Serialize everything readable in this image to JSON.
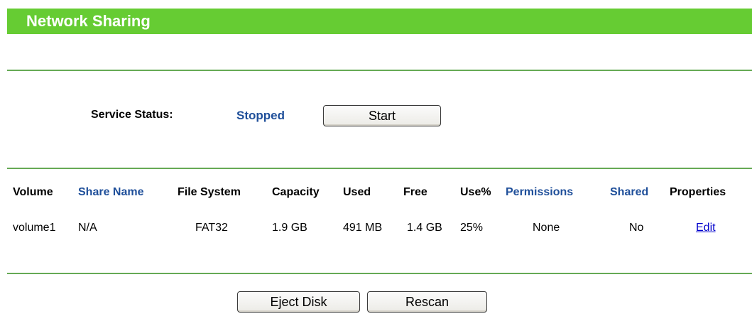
{
  "page": {
    "title": "Network Sharing"
  },
  "service": {
    "label": "Service Status:",
    "value": "Stopped",
    "start_button": "Start"
  },
  "table": {
    "columns": [
      {
        "key": "volume",
        "label": "Volume"
      },
      {
        "key": "share_name",
        "label": "Share Name"
      },
      {
        "key": "file_system",
        "label": "File System"
      },
      {
        "key": "capacity",
        "label": "Capacity"
      },
      {
        "key": "used",
        "label": "Used"
      },
      {
        "key": "free",
        "label": "Free"
      },
      {
        "key": "use_pct",
        "label": "Use%"
      },
      {
        "key": "permissions",
        "label": "Permissions"
      },
      {
        "key": "shared",
        "label": "Shared"
      },
      {
        "key": "properties",
        "label": "Properties"
      }
    ],
    "rows": [
      {
        "volume": "volume1",
        "share_name": "N/A",
        "file_system": "FAT32",
        "capacity": "1.9 GB",
        "used": "491 MB",
        "free": "1.4 GB",
        "use_pct": "25%",
        "permissions": "None",
        "shared": "No",
        "properties": "Edit"
      }
    ]
  },
  "actions": {
    "eject_button": "Eject Disk",
    "rescan_button": "Rescan"
  },
  "colors": {
    "title_bar": "#66cc33",
    "divider": "#66aa55",
    "accent_blue": "#1f4f9a",
    "link": "#0000cc"
  }
}
